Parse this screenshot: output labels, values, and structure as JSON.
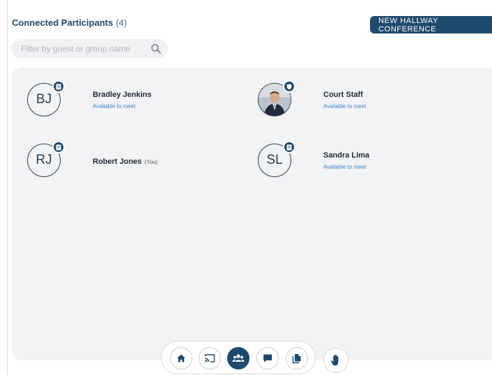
{
  "header": {
    "title": "Connected Participants",
    "count": "(4)",
    "new_conference_label": "NEW HALLWAY CONFERENCE"
  },
  "search": {
    "placeholder": "Filter by guest or group name",
    "icon": "search-icon"
  },
  "participants": [
    {
      "initials": "BJ",
      "name": "Bradley Jenkins",
      "status": "Available to meet",
      "badge_icon": "document-icon",
      "photo": false
    },
    {
      "initials": "",
      "name": "Court Staff",
      "status": "Available to meet",
      "badge_icon": "shield-icon",
      "photo": true
    },
    {
      "initials": "RJ",
      "name": "Robert Jones",
      "you_label": "(You)",
      "status": "",
      "badge_icon": "document-icon",
      "photo": false
    },
    {
      "initials": "SL",
      "name": "Sandra Lima",
      "status": "Available to meet",
      "badge_icon": "document-icon",
      "photo": false
    }
  ],
  "toolbar": {
    "items": [
      {
        "icon": "home-icon",
        "active": false
      },
      {
        "icon": "cast-icon",
        "active": false
      },
      {
        "icon": "participants-icon",
        "active": true
      },
      {
        "icon": "chat-icon",
        "active": false
      },
      {
        "icon": "documents-icon",
        "active": false
      }
    ],
    "raise_hand_icon": "raise-hand-icon"
  },
  "colors": {
    "brand": "#1e4a6e",
    "status_link": "#3f84c7",
    "panel_background": "#f2f3f4"
  }
}
